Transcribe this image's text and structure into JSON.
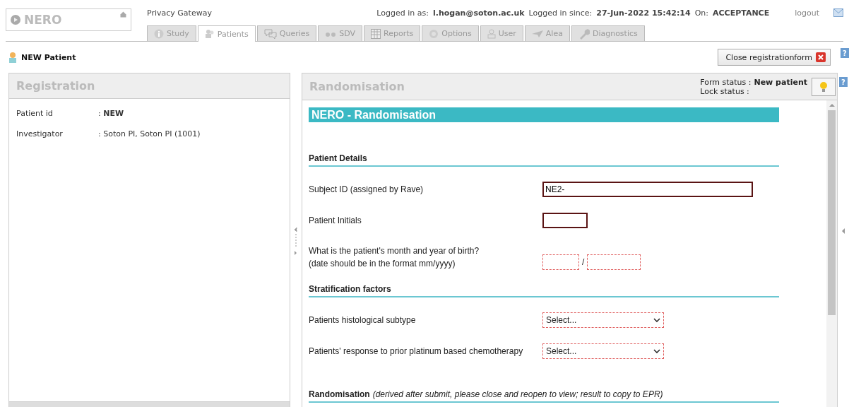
{
  "app": {
    "logo": "NERO",
    "subtitle": "Privacy Gateway"
  },
  "session": {
    "user_label": "Logged in as:",
    "user": "l.hogan@soton.ac.uk",
    "since_label": "Logged in since:",
    "since": "27-Jun-2022 15:42:14",
    "on_label": "On:",
    "environment": "ACCEPTANCE",
    "logout": "logout"
  },
  "tabs": [
    {
      "label": "Study",
      "selected": false
    },
    {
      "label": "Patients",
      "selected": true
    },
    {
      "label": "Queries",
      "selected": false
    },
    {
      "label": "SDV",
      "selected": false
    },
    {
      "label": "Reports",
      "selected": false
    },
    {
      "label": "Options",
      "selected": false
    },
    {
      "label": "User",
      "selected": false
    },
    {
      "label": "Alea",
      "selected": false
    },
    {
      "label": "Diagnostics",
      "selected": false
    }
  ],
  "page": {
    "title": "NEW Patient",
    "close_button": "Close registrationform",
    "help": "?"
  },
  "registration": {
    "title": "Registration",
    "rows": [
      {
        "label": "Patient id",
        "value": ": **NEW**"
      },
      {
        "label": "Investigator",
        "value": ": Soton PI, Soton PI (1001)"
      }
    ]
  },
  "randomisation": {
    "title": "Randomisation",
    "form_status_label": "Form status :",
    "form_status": "New patient",
    "lock_status_label": "Lock status :",
    "help": "?",
    "form": {
      "banner": "NERO - Randomisation",
      "sections": [
        {
          "heading": "Patient Details",
          "fields": [
            {
              "kind": "text",
              "label": "Subject ID (assigned by Rave)",
              "value": "NE2-",
              "highlighted": true
            },
            {
              "kind": "short_text",
              "label": "Patient Initials",
              "highlighted": true
            },
            {
              "kind": "date",
              "label": "What is the patient's month and year of birth?\n(date should be in the format mm/yyyy)",
              "separator": "/",
              "highlighted": false
            }
          ]
        },
        {
          "heading": "Stratification factors",
          "fields": [
            {
              "kind": "select",
              "label": "Patients histological subtype",
              "value": "Select...",
              "highlighted": false
            },
            {
              "kind": "select",
              "label": "Patients' response to prior platinum based chemotherapy",
              "value": "Select...",
              "highlighted": false
            }
          ]
        },
        {
          "heading": "Randomisation",
          "note": "(derived after submit, please close and reopen to view; result to copy to EPR)"
        }
      ]
    }
  }
}
